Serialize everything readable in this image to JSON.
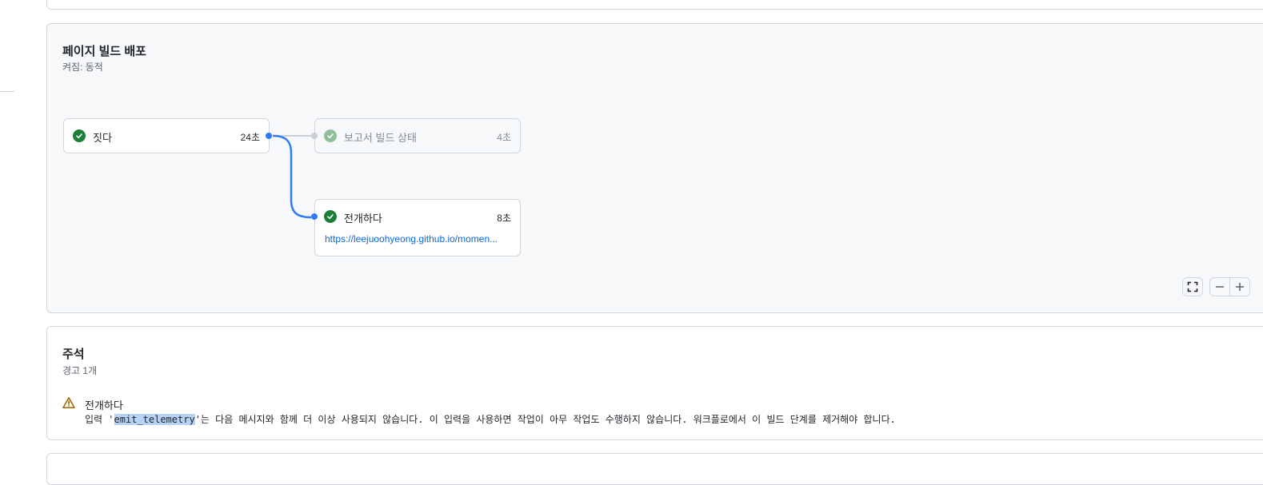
{
  "workflow": {
    "title": "페이지 빌드 배포",
    "trigger": "켜짐: 동적",
    "jobs": [
      {
        "name": "짓다",
        "duration": "24초"
      },
      {
        "name": "보고서 빌드 상태",
        "duration": "4초"
      },
      {
        "name": "전개하다",
        "duration": "8초",
        "link": "https://leejuoohyeong.github.io/momen..."
      }
    ]
  },
  "annotations": {
    "title": "주석",
    "summary": "경고 1개",
    "items": [
      {
        "job": "전개하다",
        "msg_prefix": "입력 '",
        "msg_code": "emit_telemetry",
        "msg_suffix": "'는 다음 메시지와 함께 더 이상 사용되지 않습니다. 이 입력을 사용하면 작업이 아무 작업도 수행하지 않습니다. 워크플로에서 이 빌드 단계를 제거해야 합니다."
      }
    ]
  },
  "colors": {
    "success": "#1a7f37",
    "link": "#0969da",
    "edge": "#2f7bf5",
    "warning": "#9a6700"
  }
}
